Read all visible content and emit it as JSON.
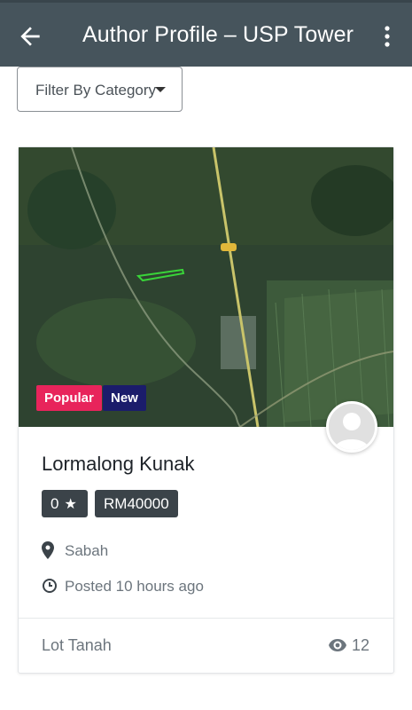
{
  "appbar": {
    "title": "Author Profile – USP Tower",
    "back_icon": "arrow-left-icon",
    "menu_icon": "more-vert-icon",
    "background": "#46545c"
  },
  "filter": {
    "label": "Filter By Category",
    "icon": "caret-down-icon"
  },
  "listing": {
    "image_alt": "Satellite map of land plot",
    "badges": {
      "popular": "Popular",
      "new": "New",
      "popular_color": "#e8245b",
      "new_color": "#1b1c6b"
    },
    "title": "Lormalong Kunak",
    "rating": "0",
    "price": "RM40000",
    "location": "Sabah",
    "posted": "Posted 10 hours ago",
    "category": "Lot Tanah",
    "views": "12"
  }
}
